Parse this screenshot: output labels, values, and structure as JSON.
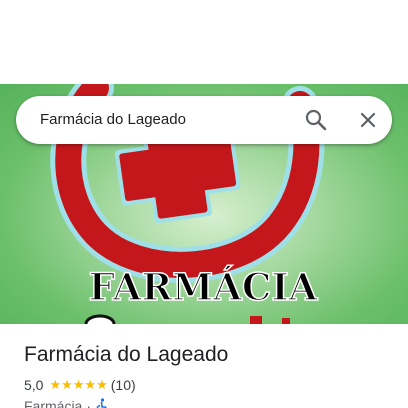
{
  "search": {
    "query": "Farmácia do Lageado"
  },
  "hero": {
    "logo_text": "FARMÁCIA"
  },
  "place": {
    "title": "Farmácia do Lageado",
    "rating": "5,0",
    "stars": "★★★★★",
    "review_count": "(10)",
    "category": "Farmácia",
    "separator": "·"
  }
}
